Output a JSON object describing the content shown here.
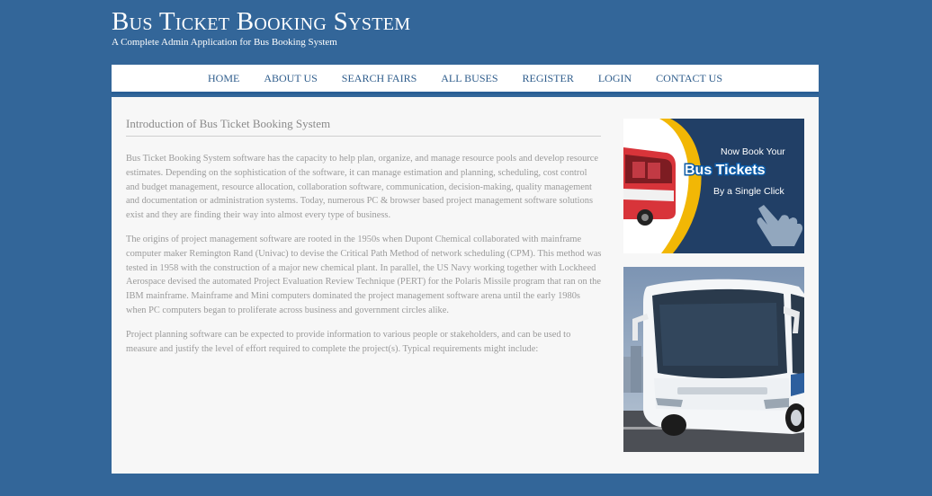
{
  "header": {
    "title": "Bus Ticket Booking System",
    "subtitle": "A Complete Admin Application for Bus Booking System"
  },
  "nav": {
    "items": [
      {
        "label": "HOME"
      },
      {
        "label": "ABOUT US"
      },
      {
        "label": "SEARCH FAIRS"
      },
      {
        "label": "ALL BUSES"
      },
      {
        "label": "REGISTER"
      },
      {
        "label": "LOGIN"
      },
      {
        "label": "CONTACT US"
      }
    ]
  },
  "main": {
    "heading": "Introduction of Bus Ticket Booking System",
    "paragraphs": [
      "Bus Ticket Booking System software has the capacity to help plan, organize, and manage resource pools and develop resource estimates. Depending on the sophistication of the software, it can manage estimation and planning, scheduling, cost control and budget management, resource allocation, collaboration software, communication, decision-making, quality management and documentation or administration systems. Today, numerous PC & browser based project management software solutions exist and they are finding their way into almost every type of business.",
      "The origins of project management software are rooted in the 1950s when Dupont Chemical collaborated with mainframe computer maker Remington Rand (Univac) to devise the Critical Path Method of network scheduling (CPM). This method was tested in 1958 with the construction of a major new chemical plant. In parallel, the US Navy working together with Lockheed Aerospace devised the automated Project Evaluation Review Technique (PERT) for the Polaris Missile program that ran on the IBM mainframe. Mainframe and Mini computers dominated the project management software arena until the early 1980s when PC computers began to proliferate across business and government circles alike.",
      "Project planning software can be expected to provide information to various people or stakeholders, and can be used to measure and justify the level of effort required to complete the project(s). Typical requirements might include:"
    ]
  },
  "sidebar": {
    "banner": {
      "line1": "Now Book Your",
      "line2": "Bus Tickets",
      "line3": "By a Single Click"
    }
  },
  "colors": {
    "page_background": "#336699",
    "nav_text": "#2f5d8c",
    "content_background": "#f7f7f7",
    "banner_background": "#1f3d63",
    "banner_accent": "#f2b705"
  }
}
